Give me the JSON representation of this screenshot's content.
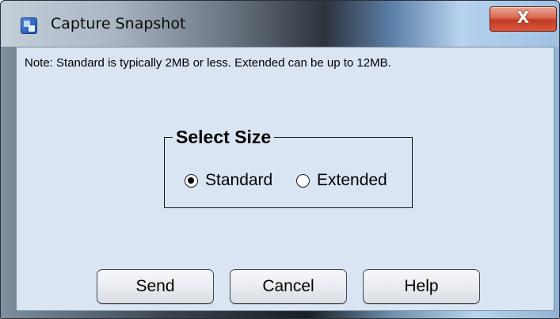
{
  "window": {
    "title": "Capture Snapshot",
    "title_icon": "app-icon",
    "close_glyph": "X",
    "close_icon": "close-icon"
  },
  "note": "Note: Standard is typically 2MB or less. Extended can be up to 12MB.",
  "size_group": {
    "title": "Select Size",
    "options": [
      {
        "label": "Standard",
        "selected": true
      },
      {
        "label": "Extended",
        "selected": false
      }
    ]
  },
  "buttons": {
    "send": "Send",
    "cancel": "Cancel",
    "help": "Help"
  },
  "colors": {
    "client_background": "#dae5f4",
    "close_button": "#c13b22"
  }
}
